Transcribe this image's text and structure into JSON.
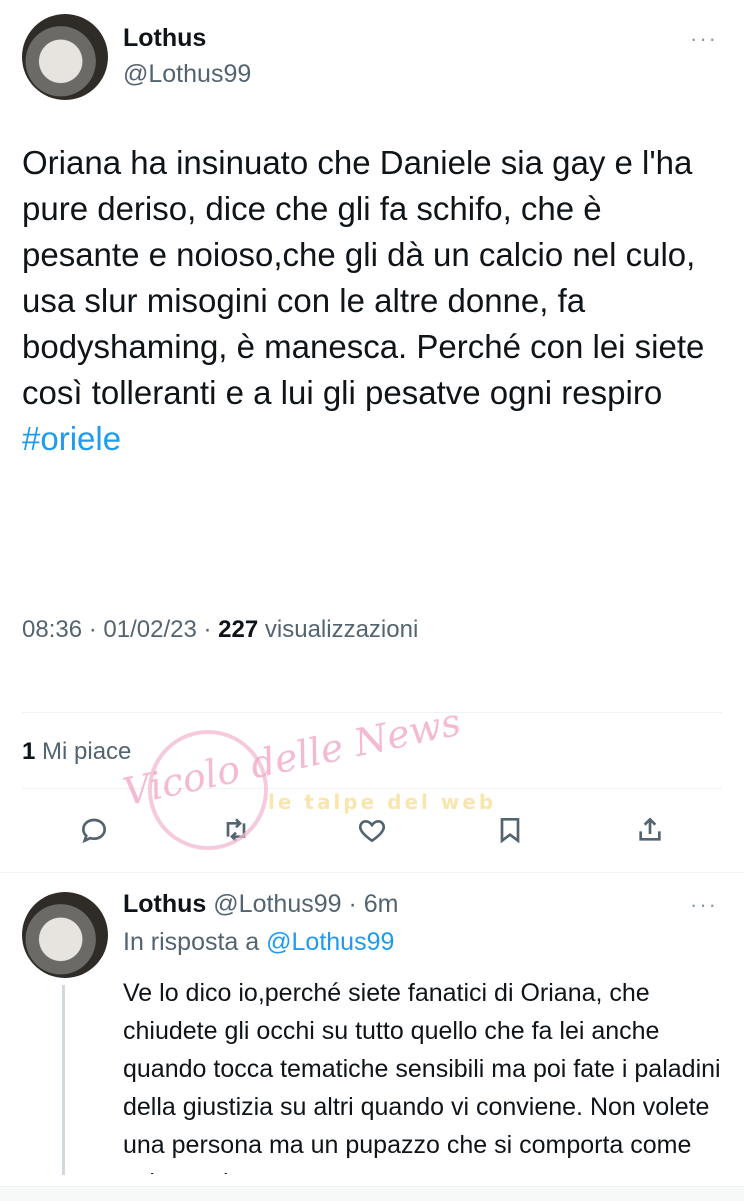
{
  "tweet": {
    "author_name": "Lothus",
    "author_handle": "@Lothus99",
    "text": "Oriana ha insinuato che Daniele sia gay e l'ha pure deriso, dice che gli fa schifo, che è pesante e noioso,che gli dà un calcio nel culo, usa slur misogini con le altre donne, fa bodyshaming, è manesca. Perché con lei siete così tolleranti e a lui gli pesatve ogni respiro",
    "hashtag": "#oriele",
    "time": "08:36",
    "date": "01/02/23",
    "views_count": "227",
    "views_label": "visualizzazioni",
    "likes_count": "1",
    "likes_label": "Mi piace",
    "more_label": "···"
  },
  "actions": {
    "reply_icon": "reply-icon",
    "retweet_icon": "retweet-icon",
    "like_icon": "heart-icon",
    "bookmark_icon": "bookmark-icon",
    "share_icon": "share-icon"
  },
  "reply": {
    "author_name": "Lothus",
    "author_handle": "@Lothus99",
    "age": "6m",
    "in_reply_to_label": "In risposta a",
    "in_reply_to_handle": "@Lothus99",
    "text": "Ve lo dico io,perché siete fanatici di Oriana, che chiudete gli occhi su tutto quello che fa lei anche quando tocca tematiche sensibili ma poi fate i paladini della giustizia su altri quando vi conviene. Non volete una persona ma un pupazzo che si comporta come volete voi",
    "more_label": "···"
  },
  "watermark": {
    "script_text": "Vicolo delle News",
    "banner_text": "le talpe del web"
  },
  "colors": {
    "accent": "#1d9bf0",
    "text_primary": "#0f1419",
    "text_secondary": "#536471",
    "divider": "#eff3f4"
  }
}
